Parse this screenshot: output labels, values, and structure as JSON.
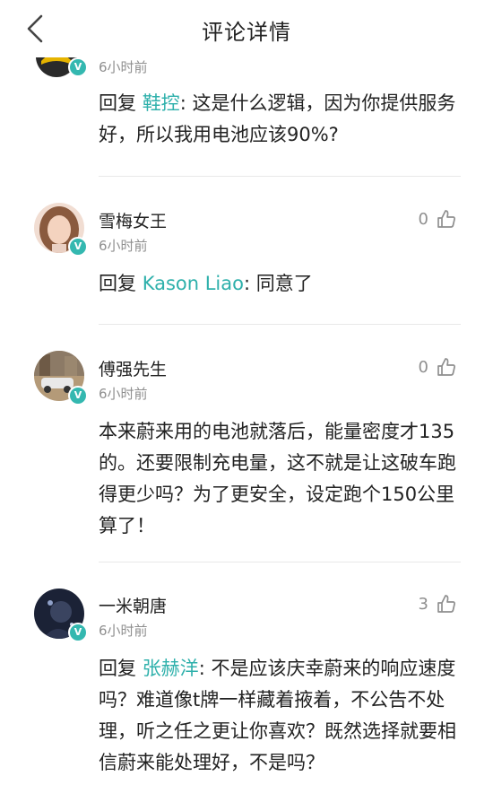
{
  "header": {
    "title": "评论详情",
    "back_icon": "chevron-left-icon"
  },
  "colors": {
    "accent": "#2eb0ab",
    "badge": "#34b8b0",
    "muted": "#8f8f8f"
  },
  "comments": [
    {
      "username": "",
      "time": "6小时前",
      "badge": "V",
      "reply_prefix": "回复 ",
      "mention": "鞋控",
      "text": ": 这是什么逻辑，因为你提供服务好，所以我用电池应该90%?"
    },
    {
      "username": "雪梅女王",
      "time": "6小时前",
      "badge": "V",
      "likes": "0",
      "reply_prefix": "回复 ",
      "mention": "Kason Liao",
      "text": ": 同意了"
    },
    {
      "username": "傅强先生",
      "time": "6小时前",
      "badge": "V",
      "likes": "0",
      "text": "本来蔚来用的电池就落后，能量密度才135的。还要限制充电量，这不就是让这破车跑得更少吗？为了更安全，设定跑个150公里算了！"
    },
    {
      "username": "一米朝唐",
      "time": "6小时前",
      "badge": "V",
      "likes": "3",
      "reply_prefix": "回复 ",
      "mention": "张赫洋",
      "text": ": 不是应该庆幸蔚来的响应速度吗？难道像t牌一样藏着掖着，不公告不处理，听之任之更让你喜欢？既然选择就要相信蔚来能处理好，不是吗？"
    }
  ]
}
